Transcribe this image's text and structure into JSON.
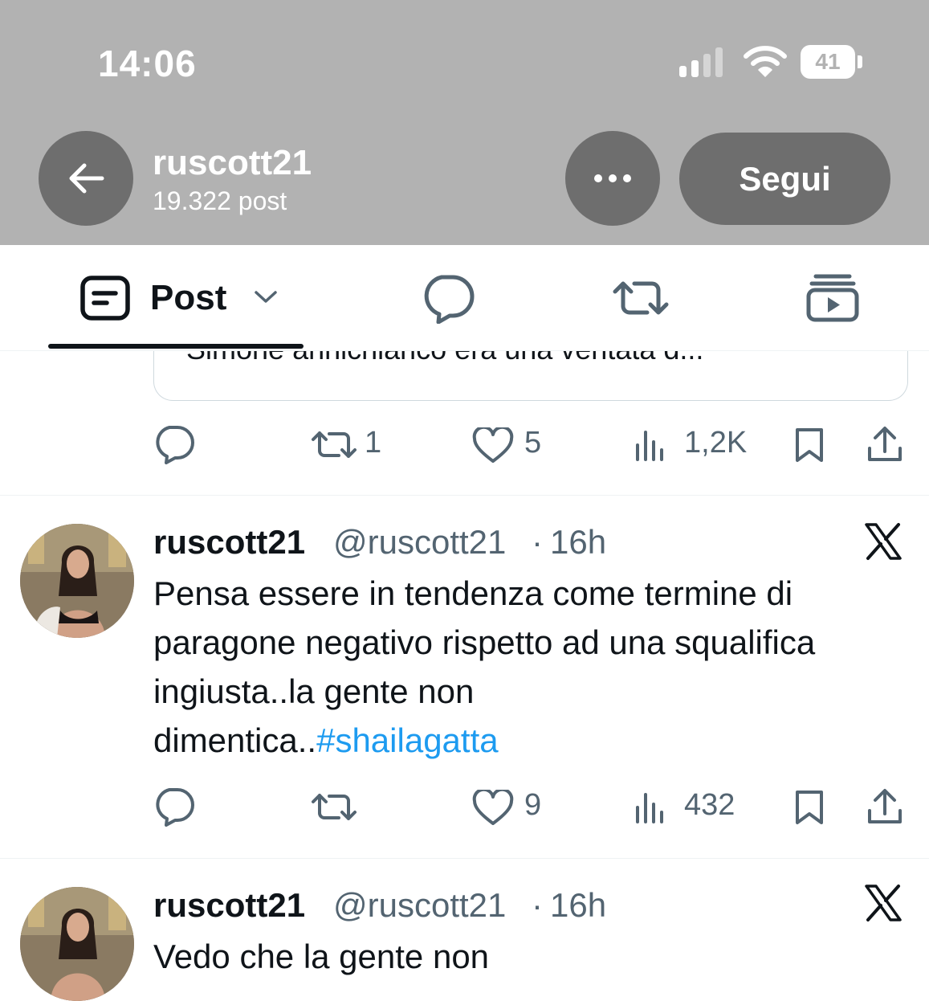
{
  "status_bar": {
    "time": "14:06",
    "battery": "41"
  },
  "profile": {
    "name": "ruscott21",
    "post_count": "19.322 post",
    "follow_label": "Segui"
  },
  "tabs": {
    "post_label": "Post"
  },
  "quoted_fragment": {
    "text": "Simone annichiarico era una ventata d..."
  },
  "first_actions": {
    "reposts": "1",
    "likes": "5",
    "views": "1,2K"
  },
  "tweets": [
    {
      "name": "ruscott21",
      "handle": "@ruscott21",
      "separator": "·",
      "time": "16h",
      "line1": "Pensa essere in tendenza come termine di",
      "line2": "paragone negativo rispetto ad una squalifica",
      "line3": "ingiusta..la gente non",
      "line4_text": "dimentica..",
      "hashtag": "#shailagatta",
      "likes": "9",
      "views": "432"
    },
    {
      "name": "ruscott21",
      "handle": "@ruscott21",
      "separator": "·",
      "time": "16h",
      "line1": "Vedo che la gente non"
    }
  ],
  "colors": {
    "header_overlay": "#b2b2b2",
    "button_grey": "#6e6e6e",
    "link": "#1d9bf0",
    "muted": "#536471"
  }
}
